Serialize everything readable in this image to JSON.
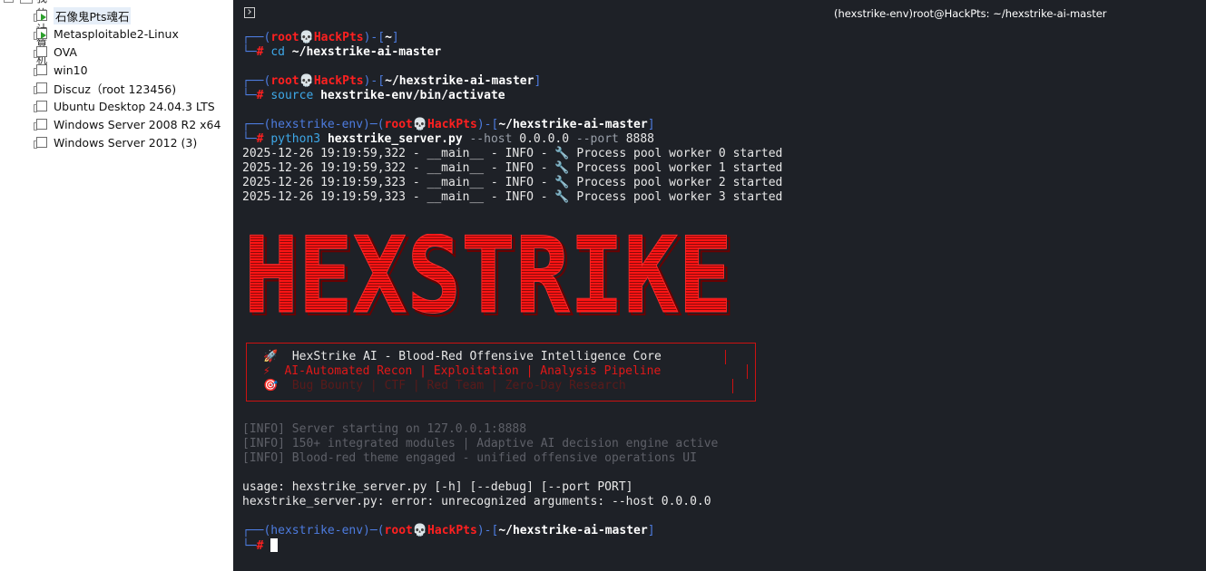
{
  "sidebar": {
    "top_label": "我的计算机",
    "items": [
      {
        "label": "石像鬼Pts魂石",
        "running": true,
        "selected": true
      },
      {
        "label": "Metasploitable2-Linux",
        "running": true,
        "selected": false
      },
      {
        "label": "OVA",
        "running": false,
        "selected": false
      },
      {
        "label": "win10",
        "running": false,
        "selected": false
      },
      {
        "label": "Discuz（root 123456)",
        "running": false,
        "selected": false
      },
      {
        "label": "Ubuntu Desktop 24.04.3 LTS",
        "running": false,
        "selected": false
      },
      {
        "label": "Windows Server 2008 R2 x64",
        "running": false,
        "selected": false
      },
      {
        "label": "Windows Server 2012 (3)",
        "running": false,
        "selected": false
      }
    ]
  },
  "terminal": {
    "window_title": "(hexstrike-env)root@HackPts: ~/hexstrike-ai-master",
    "prompt": {
      "user": "root",
      "skull": "💀",
      "host": "HackPts",
      "venv": "(hexstrike-env)",
      "home": "~",
      "dir": "~/hexstrike-ai-master",
      "symbol": "#"
    },
    "commands": {
      "cd": "cd",
      "cd_arg": "~/hexstrike-ai-master",
      "source": "source",
      "source_arg": "hexstrike-env/bin/activate",
      "python": "python3",
      "python_script": "hexstrike_server.py",
      "python_opt1": "--host",
      "python_val1": "0.0.0.0",
      "python_opt2": "--port",
      "python_val2": "8888"
    },
    "log_lines": [
      "2025-12-26 19:19:59,322 - __main__ - INFO - 🔧 Process pool worker 0 started",
      "2025-12-26 19:19:59,322 - __main__ - INFO - 🔧 Process pool worker 1 started",
      "2025-12-26 19:19:59,323 - __main__ - INFO - 🔧 Process pool worker 2 started",
      "2025-12-26 19:19:59,323 - __main__ - INFO - 🔧 Process pool worker 3 started"
    ],
    "banner_text": "HEXSTRIKE",
    "box_lines": [
      "🚀  HexStrike AI - Blood-Red Offensive Intelligence Core",
      "⚡  AI-Automated Recon | Exploitation | Analysis Pipeline",
      "🎯  Bug Bounty | CTF | Red Team | Zero-Day Research"
    ],
    "info_lines": [
      "[INFO] Server starting on 127.0.0.1:8888",
      "[INFO] 150+ integrated modules | Adaptive AI decision engine active",
      "[INFO] Blood-red theme engaged - unified offensive operations UI"
    ],
    "usage_line": "usage: hexstrike_server.py [-h] [--debug] [--port PORT]",
    "error_line": "hexstrike_server.py: error: unrecognized arguments: --host 0.0.0.0"
  },
  "colors": {
    "terminal_bg": "#1e2127",
    "prompt_blue": "#4d7ce0",
    "prompt_red": "#ff2020",
    "banner_red": "#ff1010"
  }
}
